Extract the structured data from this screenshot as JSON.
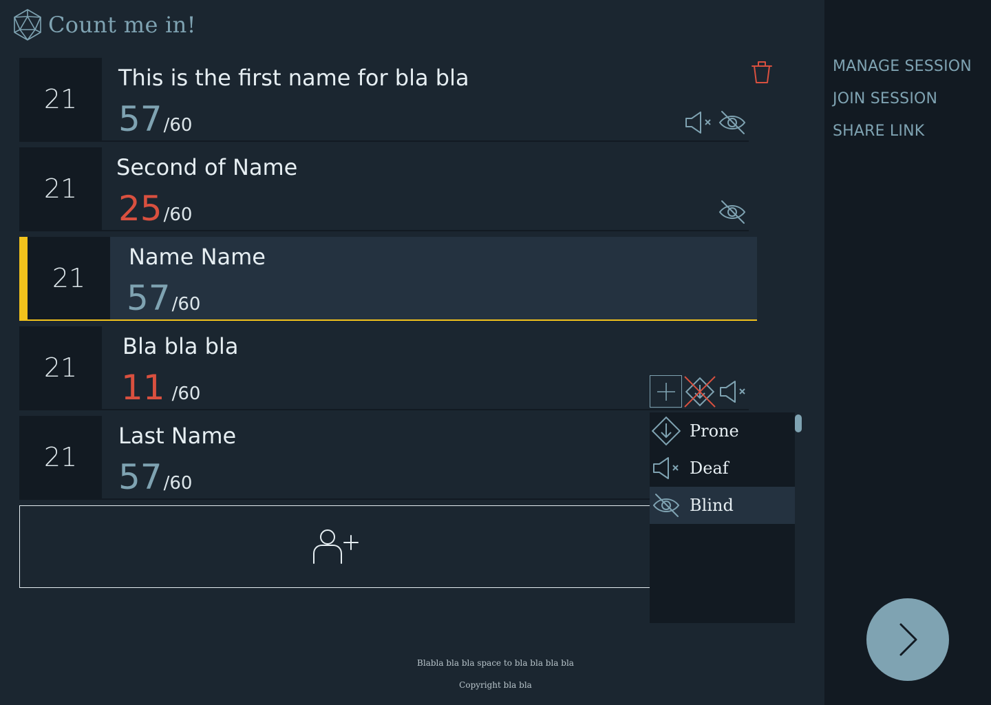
{
  "app": {
    "title": "Count me in!"
  },
  "combatants": [
    {
      "initiative": "21",
      "name": "This is the first name for bla bla",
      "hp_current": "57",
      "hp_max": "/60",
      "hp_status": "ok"
    },
    {
      "initiative": "21",
      "name": "Second of Name",
      "hp_current": "25",
      "hp_max": "/60",
      "hp_status": "low"
    },
    {
      "initiative": "21",
      "name": "Name Name",
      "hp_current": "57",
      "hp_max": "/60",
      "hp_status": "ok",
      "active": true
    },
    {
      "initiative": "21",
      "name": "Bla bla bla",
      "hp_current": "11",
      "hp_max": "/60",
      "hp_status": "low"
    },
    {
      "initiative": "21",
      "name": "Last Name",
      "hp_current": "57",
      "hp_max": "/60",
      "hp_status": "ok"
    }
  ],
  "conditions_menu": {
    "items": [
      {
        "label": "Prone",
        "icon": "prone-icon"
      },
      {
        "label": "Deaf",
        "icon": "deaf-icon"
      },
      {
        "label": "Blind",
        "icon": "blind-icon",
        "selected": true
      }
    ]
  },
  "nav": {
    "manage_session": "MANAGE SESSION",
    "join_session": "JOIN SESSION",
    "share_link": "SHARE LINK"
  },
  "footer": {
    "tagline": "Blabla bla bla space to bla bla bla bla",
    "copyright": "Copyright bla bla"
  },
  "colors": {
    "background": "#1b2630",
    "panel_dark": "#121a22",
    "accent_blue": "#7fa3b2",
    "accent_yellow": "#f3c31c",
    "danger_red": "#d9503f"
  }
}
